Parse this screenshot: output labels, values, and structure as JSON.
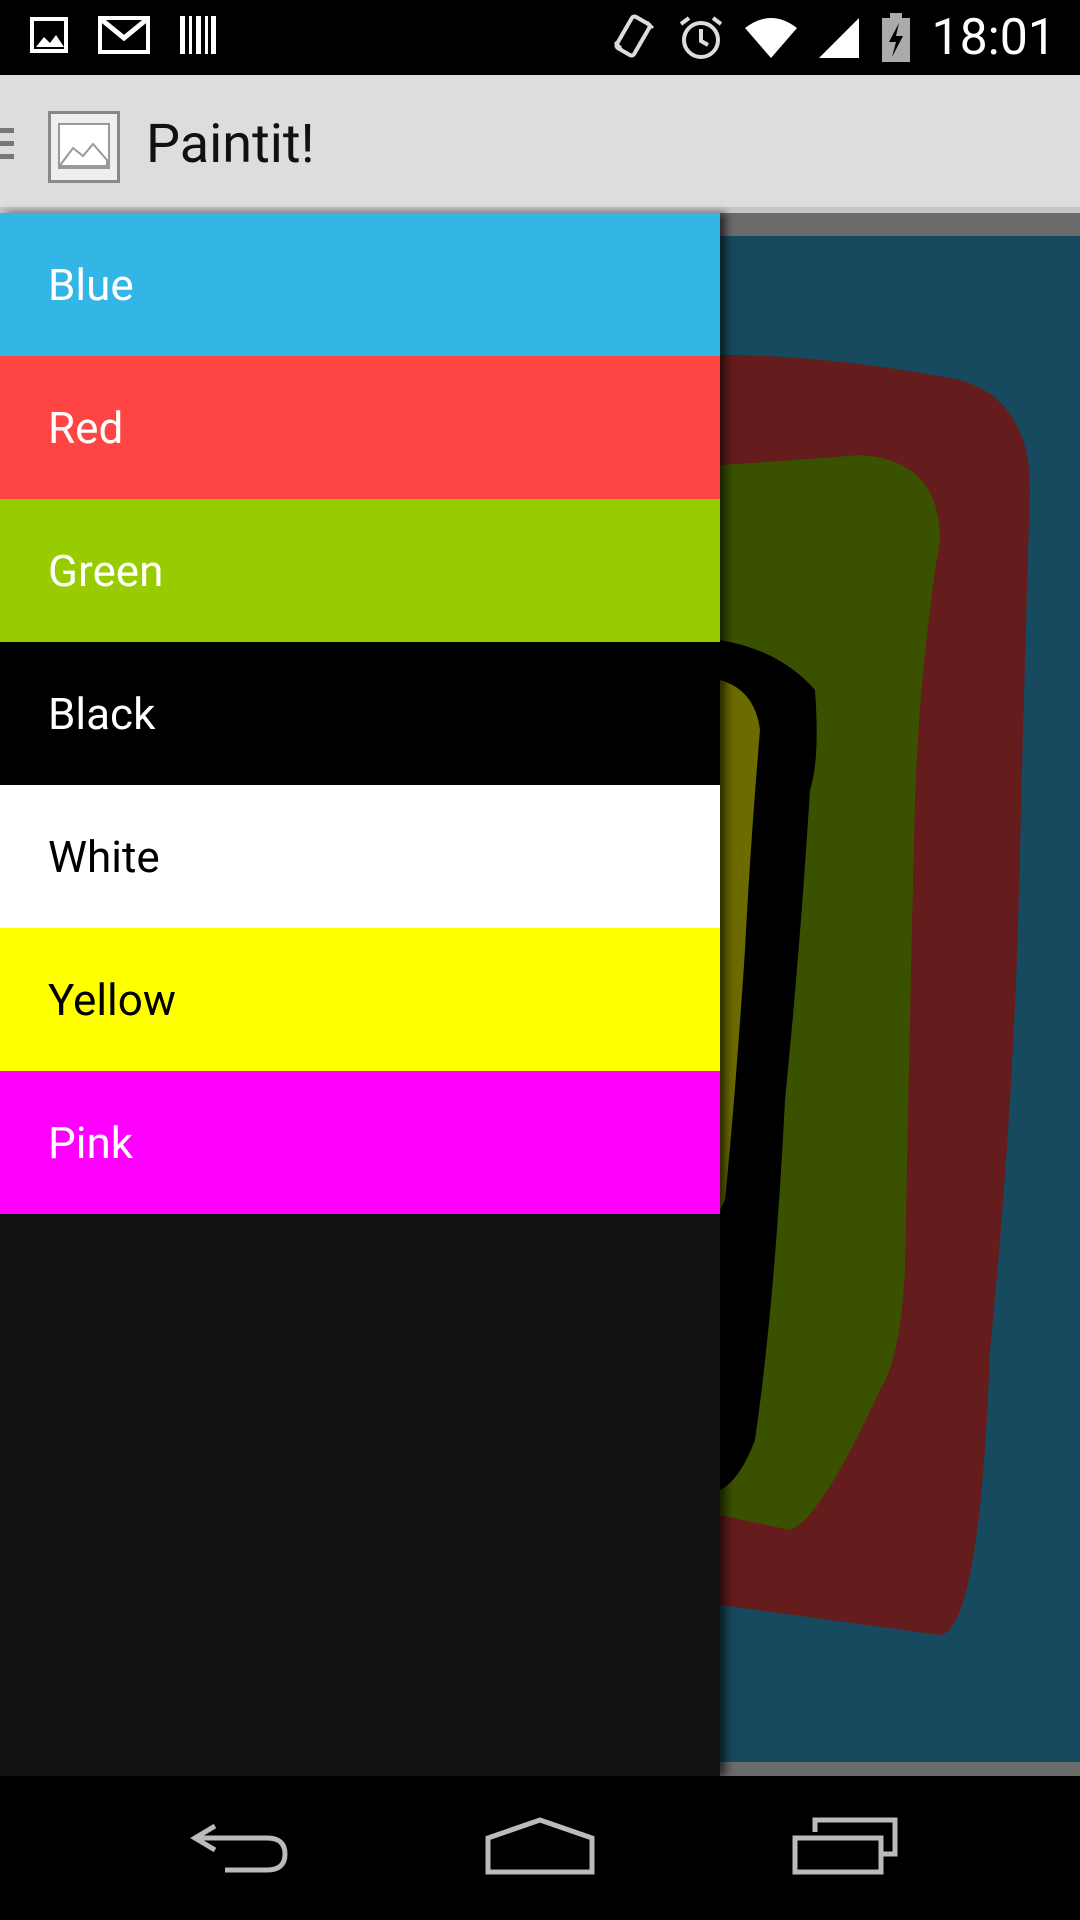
{
  "status_bar": {
    "time": "18:01",
    "left_icons": [
      "image-icon",
      "gmail-icon",
      "barcode-icon"
    ],
    "right_icons": [
      "vibrate-icon",
      "alarm-icon",
      "wifi-icon",
      "signal-icon",
      "battery-charging-icon"
    ]
  },
  "action_bar": {
    "title": "Paintit!",
    "app_icon": "image-icon"
  },
  "drawer": {
    "items": [
      {
        "label": "Blue",
        "bg": "#33b5e5",
        "fg": "#ffffff"
      },
      {
        "label": "Red",
        "bg": "#ff4444",
        "fg": "#ffffff"
      },
      {
        "label": "Green",
        "bg": "#99cc00",
        "fg": "#ffffff"
      },
      {
        "label": "Black",
        "bg": "#000000",
        "fg": "#ffffff"
      },
      {
        "label": "White",
        "bg": "#ffffff",
        "fg": "#000000"
      },
      {
        "label": "Yellow",
        "bg": "#ffff00",
        "fg": "#000000"
      },
      {
        "label": "Pink",
        "bg": "#ff00ff",
        "fg": "#ffffff"
      }
    ],
    "background": "#111111"
  },
  "canvas": {
    "background": "#174a5e",
    "stroke_colors": [
      "#651c1c",
      "#3a5200",
      "#000000",
      "#6b6b00"
    ]
  },
  "nav_bar": {
    "buttons": [
      "back-icon",
      "home-icon",
      "recents-icon"
    ]
  }
}
